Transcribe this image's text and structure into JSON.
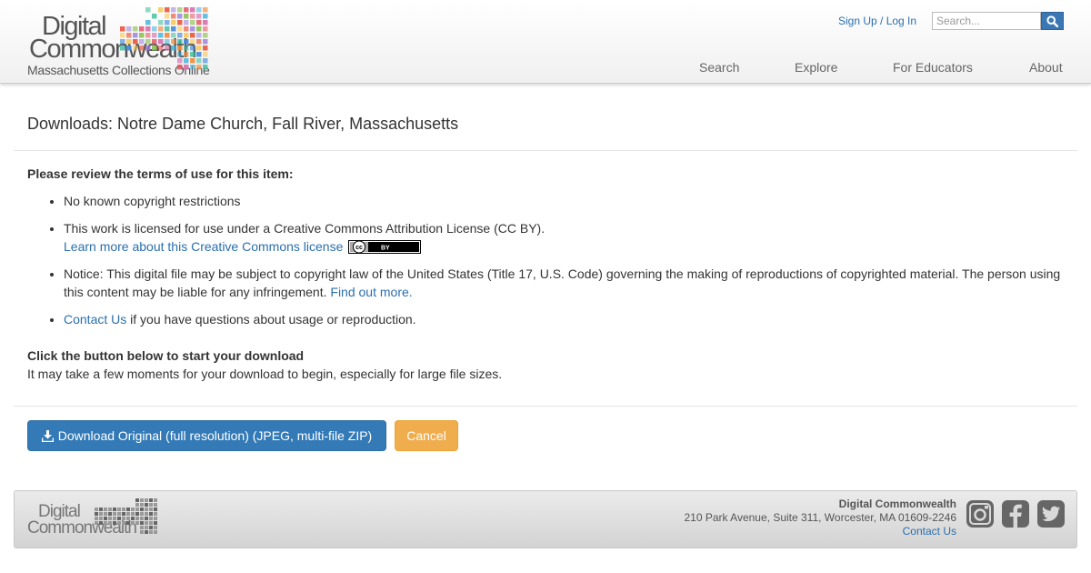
{
  "header": {
    "logo": {
      "line1": "Digital",
      "line2": "Commonwealth",
      "tagline": "Massachusetts Collections Online"
    },
    "signup_label": "Sign Up / Log In",
    "search": {
      "placeholder": "Search...",
      "icon": "magnifier-icon"
    },
    "nav": [
      {
        "label": "Search"
      },
      {
        "label": "Explore"
      },
      {
        "label": "For Educators"
      },
      {
        "label": "About"
      }
    ]
  },
  "main": {
    "title": "Downloads: Notre Dame Church, Fall River, Massachusetts",
    "terms_heading": "Please review the terms of use for this item:",
    "terms": {
      "item1": "No known copyright restrictions",
      "item2_text": "This work is licensed for use under a Creative Commons Attribution License (CC BY).",
      "item2_link": "Learn more about this Creative Commons license",
      "cc_badge": {
        "cc": "cc",
        "by": "BY"
      },
      "item3_text": "Notice: This digital file may be subject to copyright law of the United States (Title 17, U.S. Code) governing the making of reproductions of copyrighted material. The person using this content may be liable for any infringement.",
      "item3_link": "Find out more.",
      "item4_link": "Contact Us",
      "item4_text": " if you have questions about usage or reproduction."
    },
    "download_heading": "Click the button below to start your download",
    "download_note": "It may take a few moments for your download to begin, especially for large file sizes.",
    "download_button": "Download Original (full resolution) (JPEG, multi-file ZIP)",
    "cancel_button": "Cancel"
  },
  "footer": {
    "logo": {
      "line1": "Digital",
      "line2": "Commonwealth"
    },
    "org": "Digital Commonwealth",
    "address": "210 Park Avenue, Suite 311, Worcester, MA 01609-2246",
    "contact": "Contact Us",
    "social": [
      {
        "icon": "instagram-icon"
      },
      {
        "icon": "facebook-icon"
      },
      {
        "icon": "twitter-icon"
      }
    ]
  },
  "colors": {
    "link": "#2a6fae",
    "primary_button": "#337ab7",
    "warning_button": "#f0ad4e",
    "footer_bg": "#d9d9d9"
  }
}
